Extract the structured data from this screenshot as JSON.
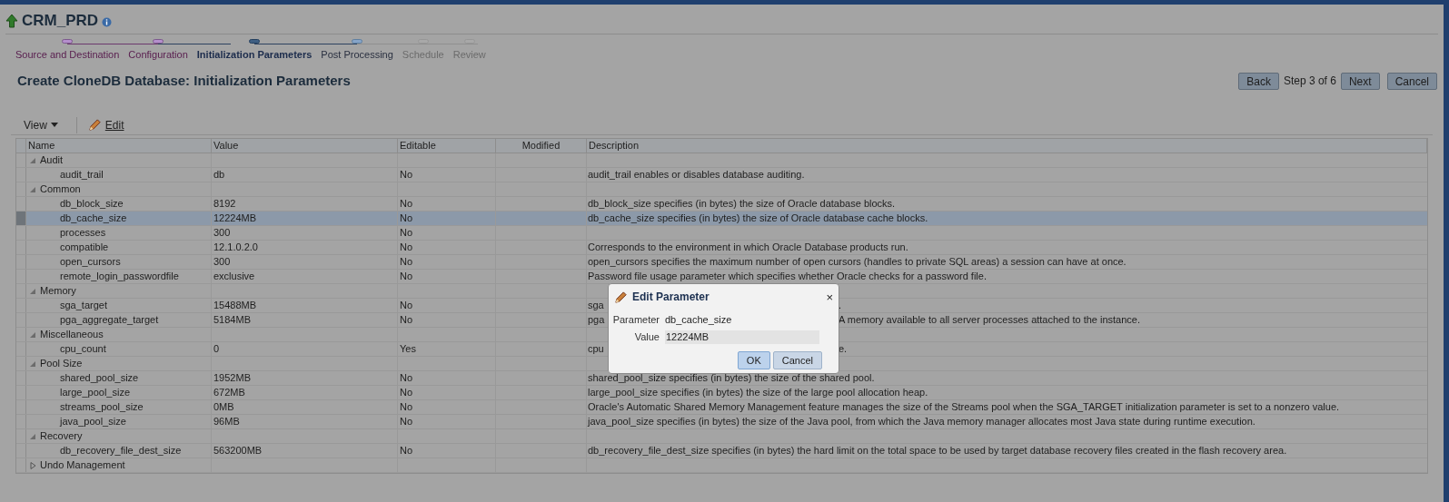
{
  "header": {
    "title": "CRM_PRD"
  },
  "train": [
    {
      "label": "Source and Destination",
      "visited": true,
      "selected": false,
      "disabled": false
    },
    {
      "label": "Configuration",
      "visited": true,
      "selected": false,
      "disabled": false
    },
    {
      "label": "Initialization Parameters",
      "visited": false,
      "selected": true,
      "disabled": false
    },
    {
      "label": "Post Processing",
      "visited": false,
      "selected": false,
      "disabled": false
    },
    {
      "label": "Schedule",
      "visited": false,
      "selected": false,
      "disabled": true
    },
    {
      "label": "Review",
      "visited": false,
      "selected": false,
      "disabled": true
    }
  ],
  "page_title": "Create CloneDB Database: Initialization Parameters",
  "nav": {
    "back": "Back",
    "step": "Step 3 of 6",
    "next": "Next",
    "cancel": "Cancel"
  },
  "toolbar": {
    "view": "View",
    "edit": "Edit"
  },
  "table": {
    "columns": [
      "Name",
      "Value",
      "Editable",
      "Modified",
      "Description"
    ],
    "groups": [
      {
        "name": "Audit",
        "expanded": true,
        "children": [
          {
            "name": "audit_trail",
            "value": "db",
            "editable": "No",
            "description": [
              "audit_trail enables or disables database auditing."
            ],
            "selected": false
          }
        ]
      },
      {
        "name": "Common",
        "expanded": true,
        "children": [
          {
            "name": "db_block_size",
            "value": "8192",
            "editable": "No",
            "description": [
              "db_block_size specifies (in bytes) the size of Oracle database blocks."
            ],
            "selected": false
          },
          {
            "name": "db_cache_size",
            "value": "12224MB",
            "editable": "No",
            "description": [
              "db_cache_size specifies (in bytes) the size of Oracle database cache blocks."
            ],
            "selected": true
          },
          {
            "name": "processes",
            "value": "300",
            "editable": "No",
            "selected": false
          },
          {
            "name": "compatible",
            "value": "12.1.0.2.0",
            "editable": "No",
            "description": [
              "Corresponds to the environment in which Oracle Database products run."
            ],
            "selected": false
          },
          {
            "name": "open_cursors",
            "value": "300",
            "editable": "No",
            "description": [
              "open_cursors specifies the maximum number of open cursors (handles to private SQL areas) a session can have at once."
            ],
            "selected": false
          },
          {
            "name": "remote_login_passwordfile",
            "value": "exclusive",
            "editable": "No",
            "description": [
              "Password file usage parameter which specifies whether Oracle checks for a password file."
            ],
            "selected": false
          }
        ]
      },
      {
        "name": "Memory",
        "expanded": true,
        "children": [
          {
            "name": "sga_target",
            "value": "15488MB",
            "editable": "No",
            "description": [
              "sga",
              "."
            ],
            "selected": false
          },
          {
            "name": "pga_aggregate_target",
            "value": "5184MB",
            "editable": "No",
            "description": [
              "pga",
              "A memory available to all server processes attached to the instance."
            ],
            "selected": false
          }
        ]
      },
      {
        "name": "Miscellaneous",
        "expanded": true,
        "children": [
          {
            "name": "cpu_count",
            "value": "0",
            "editable": "Yes",
            "description": [
              "cpu",
              "e."
            ],
            "selected": false
          }
        ]
      },
      {
        "name": "Pool Size",
        "expanded": true,
        "children": [
          {
            "name": "shared_pool_size",
            "value": "1952MB",
            "editable": "No",
            "description": [
              "shared_pool_size specifies (in bytes) the size of the shared pool."
            ],
            "selected": false
          },
          {
            "name": "large_pool_size",
            "value": "672MB",
            "editable": "No",
            "description": [
              "large_pool_size specifies (in bytes) the size of the large pool allocation heap."
            ],
            "selected": false
          },
          {
            "name": "streams_pool_size",
            "value": "0MB",
            "editable": "No",
            "description": [
              "Oracle's Automatic Shared Memory Management feature manages the size of the Streams pool when the SGA_TARGET initialization parameter is set to a nonzero value."
            ],
            "selected": false
          },
          {
            "name": "java_pool_size",
            "value": "96MB",
            "editable": "No",
            "description": [
              "java_pool_size specifies (in bytes) the size of the Java pool, from which the Java memory manager allocates most Java state during runtime execution."
            ],
            "selected": false
          }
        ]
      },
      {
        "name": "Recovery",
        "expanded": true,
        "children": [
          {
            "name": "db_recovery_file_dest_size",
            "value": "563200MB",
            "editable": "No",
            "description": [
              "db_recovery_file_dest_size specifies (in bytes) the hard limit on the total space to be used by target database recovery files created in the flash recovery area."
            ],
            "selected": false
          }
        ]
      },
      {
        "name": "Undo Management",
        "expanded": false
      }
    ]
  },
  "dialog": {
    "title": "Edit Parameter",
    "close": "×",
    "fields": [
      {
        "label": "Parameter",
        "kind": "text",
        "value": "db_cache_size"
      },
      {
        "label": "Value",
        "kind": "input",
        "value": "12224MB"
      }
    ],
    "buttons": [
      {
        "label": "OK",
        "default": true
      },
      {
        "label": "Cancel",
        "default": false
      }
    ]
  }
}
